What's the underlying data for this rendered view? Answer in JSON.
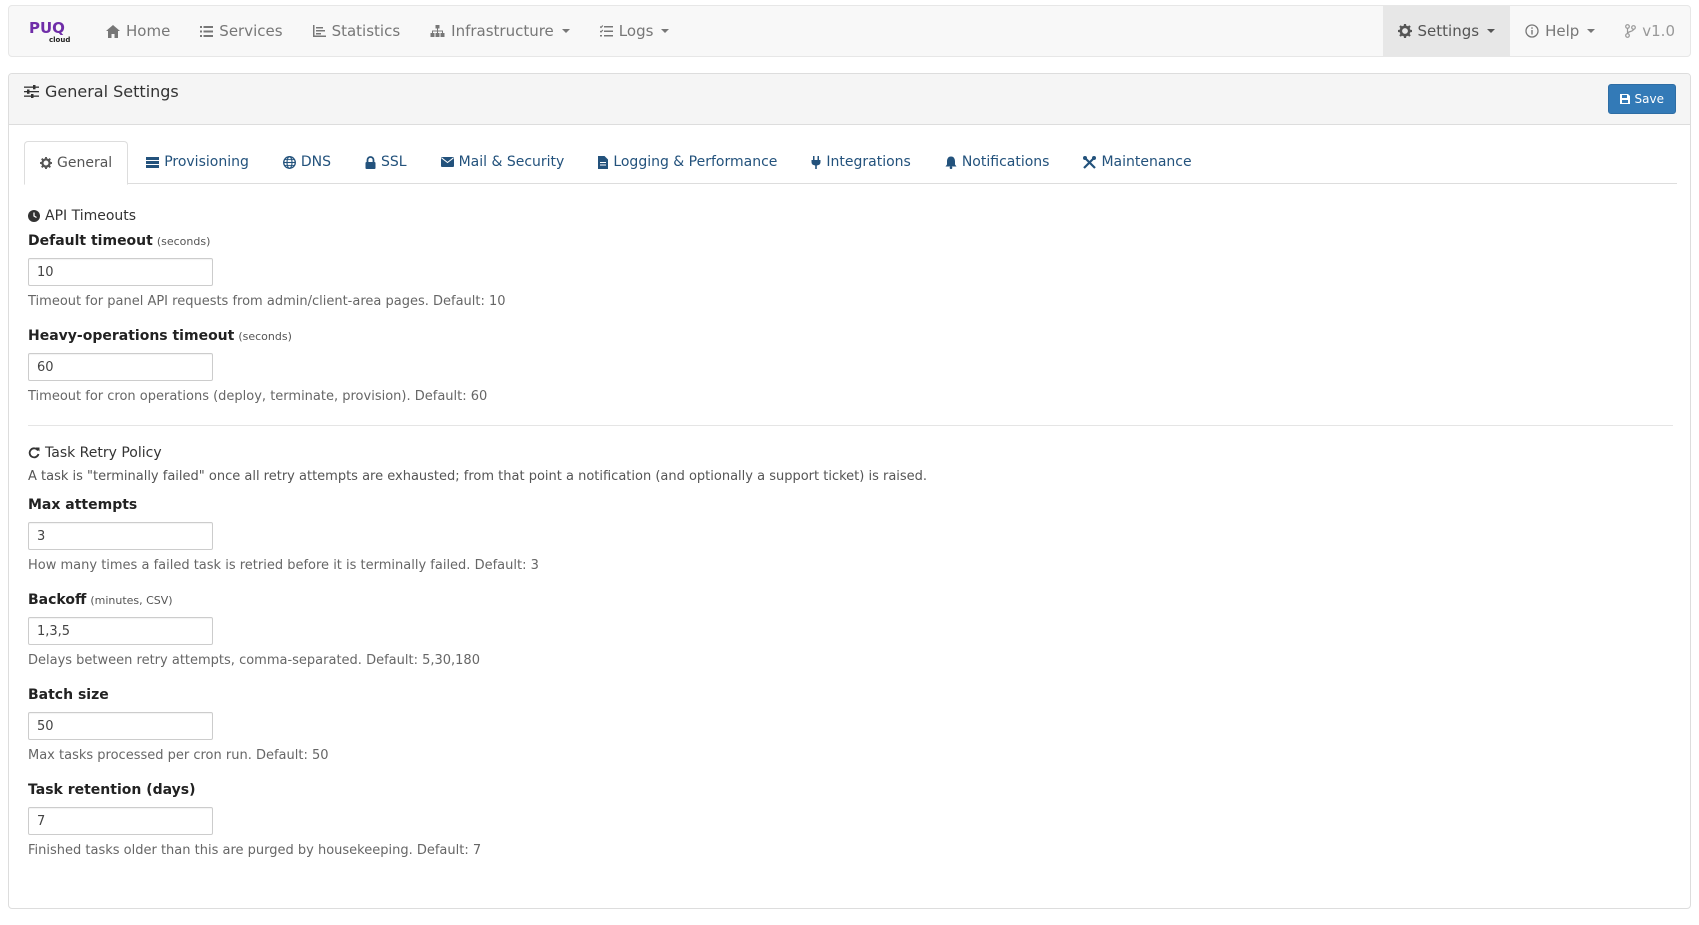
{
  "brand": {
    "name": "PUQ",
    "sub": "cloud",
    "color": "#6f2da8"
  },
  "nav": {
    "left": [
      {
        "label": "Home",
        "icon": "home-icon"
      },
      {
        "label": "Services",
        "icon": "list-icon"
      },
      {
        "label": "Statistics",
        "icon": "chart-icon"
      },
      {
        "label": "Infrastructure",
        "icon": "sitemap-icon"
      },
      {
        "label": "Logs",
        "icon": "tasks-icon"
      }
    ],
    "right": [
      {
        "label": "Settings",
        "icon": "gear-icon"
      },
      {
        "label": "Help",
        "icon": "info-icon"
      },
      {
        "label": "v1.0",
        "icon": "branch-icon"
      }
    ]
  },
  "panel": {
    "title": "General Settings",
    "save_label": "Save"
  },
  "tabs": [
    "General",
    "Provisioning",
    "DNS",
    "SSL",
    "Mail & Security",
    "Logging & Performance",
    "Integrations",
    "Notifications",
    "Maintenance"
  ],
  "api_timeouts": {
    "title": "API Timeouts",
    "default_timeout": {
      "label": "Default timeout",
      "unit": "(seconds)",
      "value": "10",
      "help": "Timeout for panel API requests from admin/client-area pages. Default: 10"
    },
    "heavy_timeout": {
      "label": "Heavy-operations timeout",
      "unit": "(seconds)",
      "value": "60",
      "help": "Timeout for cron operations (deploy, terminate, provision). Default: 60"
    }
  },
  "retry": {
    "title": "Task Retry Policy",
    "intro": "A task is \"terminally failed\" once all retry attempts are exhausted; from that point a notification (and optionally a support ticket) is raised.",
    "max_attempts": {
      "label": "Max attempts",
      "value": "3",
      "help": "How many times a failed task is retried before it is terminally failed. Default: 3"
    },
    "backoff": {
      "label": "Backoff",
      "unit": "(minutes, CSV)",
      "value": "1,3,5",
      "help": "Delays between retry attempts, comma-separated. Default: 5,30,180"
    },
    "batch_size": {
      "label": "Batch size",
      "value": "50",
      "help": "Max tasks processed per cron run. Default: 50"
    },
    "retention": {
      "label": "Task retention (days)",
      "value": "7",
      "help": "Finished tasks older than this are purged by housekeeping. Default: 7"
    }
  }
}
